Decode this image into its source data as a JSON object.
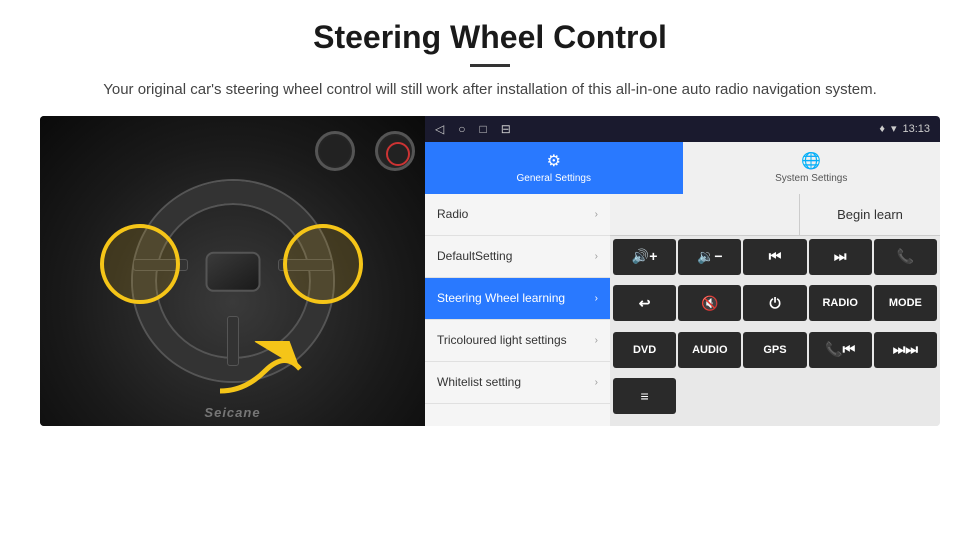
{
  "page": {
    "title": "Steering Wheel Control",
    "divider": true,
    "subtitle": "Your original car's steering wheel control will still work after installation of this all-in-one auto radio navigation system."
  },
  "status_bar": {
    "nav_icons": [
      "◁",
      "○",
      "□",
      "⊟"
    ],
    "right": "♦ ▾ 13:13"
  },
  "tabs": [
    {
      "id": "general",
      "icon": "⚙",
      "label": "General Settings",
      "active": true
    },
    {
      "id": "system",
      "icon": "🌐",
      "label": "System Settings",
      "active": false
    }
  ],
  "menu": [
    {
      "id": "radio",
      "label": "Radio",
      "highlighted": false
    },
    {
      "id": "default",
      "label": "DefaultSetting",
      "highlighted": false
    },
    {
      "id": "steering",
      "label": "Steering Wheel learning",
      "highlighted": true
    },
    {
      "id": "tricoloured",
      "label": "Tricoloured light settings",
      "highlighted": false
    },
    {
      "id": "whitelist",
      "label": "Whitelist setting",
      "highlighted": false
    }
  ],
  "right_panel": {
    "begin_learn_label": "Begin learn",
    "buttons_row1": [
      {
        "id": "vol-up",
        "label": "🔊+",
        "icon": true
      },
      {
        "id": "vol-down",
        "label": "🔉−",
        "icon": true
      },
      {
        "id": "prev-track",
        "label": "⏮",
        "icon": true
      },
      {
        "id": "next-track",
        "label": "⏭",
        "icon": true
      },
      {
        "id": "phone",
        "label": "📞",
        "icon": true
      }
    ],
    "buttons_row2": [
      {
        "id": "hang-up",
        "label": "↩",
        "icon": true
      },
      {
        "id": "mute",
        "label": "🔇",
        "icon": true
      },
      {
        "id": "power",
        "label": "⏻",
        "icon": true
      },
      {
        "id": "radio-btn",
        "label": "RADIO",
        "icon": false
      },
      {
        "id": "mode",
        "label": "MODE",
        "icon": false
      }
    ],
    "buttons_row3": [
      {
        "id": "dvd",
        "label": "DVD",
        "icon": false
      },
      {
        "id": "audio",
        "label": "AUDIO",
        "icon": false
      },
      {
        "id": "gps",
        "label": "GPS",
        "icon": false
      },
      {
        "id": "phone2",
        "label": "📞⏮",
        "icon": true
      },
      {
        "id": "skip2",
        "label": "⏭⏭",
        "icon": true
      }
    ],
    "buttons_row4": [
      {
        "id": "list",
        "label": "≡",
        "icon": true
      }
    ]
  },
  "watermark": "Seicane"
}
